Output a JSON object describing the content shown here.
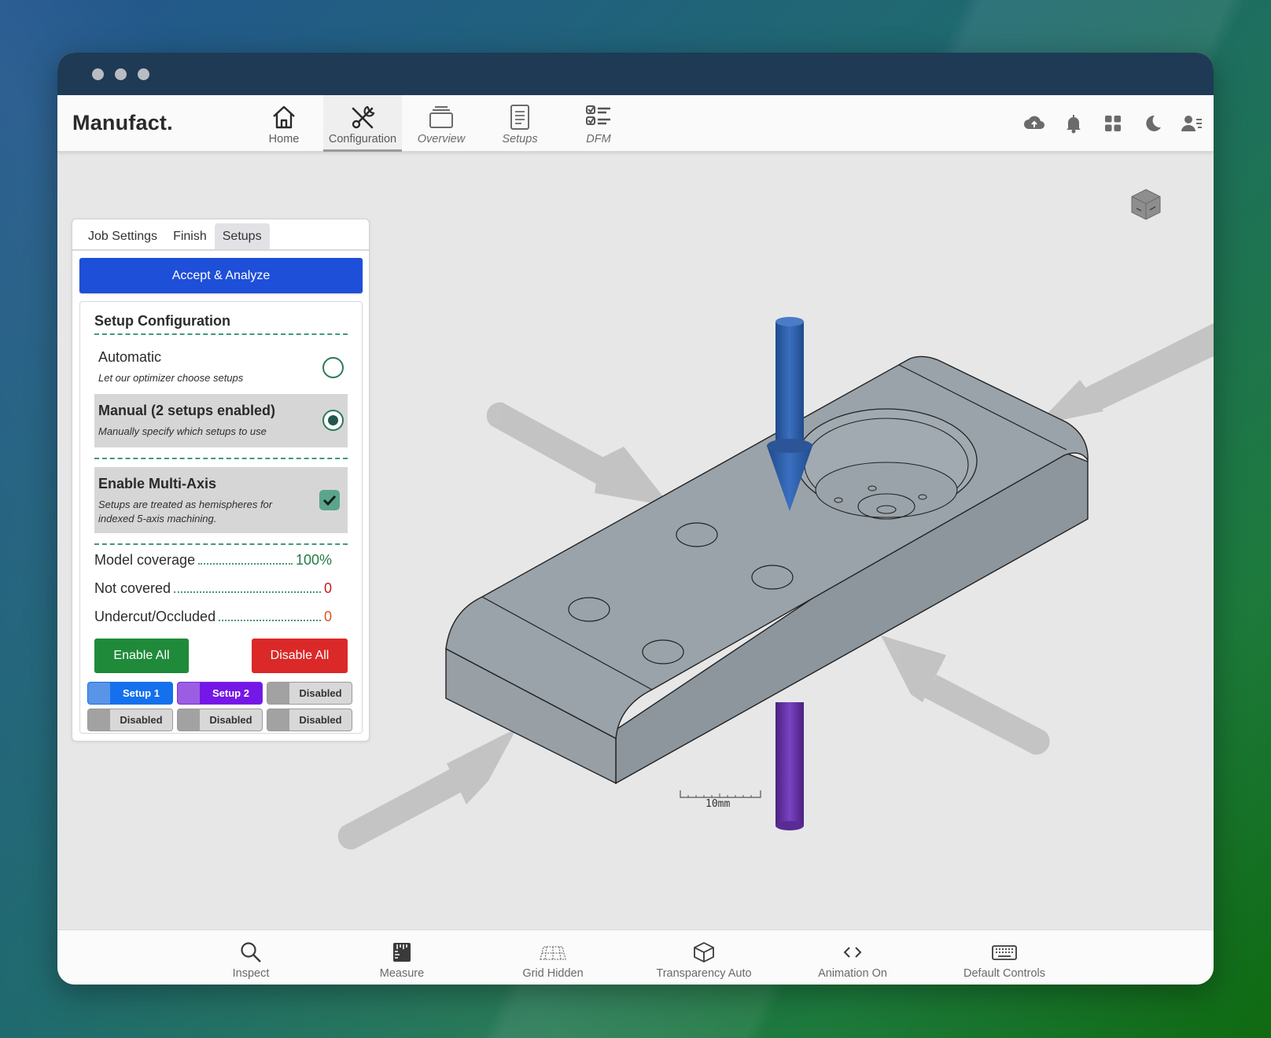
{
  "app": {
    "brand": "Manufact."
  },
  "nav": {
    "items": [
      {
        "label": "Home",
        "icon": "home-icon",
        "active": false
      },
      {
        "label": "Configuration",
        "icon": "tools-icon",
        "active": true
      },
      {
        "label": "Overview",
        "icon": "layers-icon",
        "active": false
      },
      {
        "label": "Setups",
        "icon": "list-icon",
        "active": false
      },
      {
        "label": "DFM",
        "icon": "checklist-icon",
        "active": false
      }
    ],
    "right_icons": [
      "cloud-upload-icon",
      "bell-icon",
      "grid-icon",
      "moon-icon",
      "user-menu-icon"
    ]
  },
  "panel": {
    "tabs": [
      "Job Settings",
      "Finish",
      "Setups"
    ],
    "active_tab": "Setups",
    "accept_label": "Accept & Analyze",
    "config_title": "Setup Configuration",
    "automatic": {
      "title": "Automatic",
      "desc": "Let our optimizer choose setups",
      "selected": false
    },
    "manual": {
      "title": "Manual (2 setups enabled)",
      "desc": "Manually specify which setups to use",
      "selected": true
    },
    "multi_axis": {
      "title": "Enable Multi-Axis",
      "desc_line1": "Setups are treated as hemispheres for",
      "desc_line2": "indexed 5-axis machining.",
      "checked": true
    },
    "stats": {
      "model_coverage_label": "Model coverage",
      "model_coverage_value": "100%",
      "not_covered_label": "Not covered",
      "not_covered_value": "0",
      "undercut_label": "Undercut/Occluded",
      "undercut_value": "0"
    },
    "enable_all_label": "Enable All",
    "disable_all_label": "Disable All",
    "setups": [
      {
        "label": "Setup 1",
        "state": "blue"
      },
      {
        "label": "Setup 2",
        "state": "purple"
      },
      {
        "label": "Disabled",
        "state": "gray"
      },
      {
        "label": "Disabled",
        "state": "gray"
      },
      {
        "label": "Disabled",
        "state": "gray"
      },
      {
        "label": "Disabled",
        "state": "gray"
      }
    ]
  },
  "viewport": {
    "scale_label": "10mm",
    "colors": {
      "part": "#9aa3a9",
      "tool_blue": "#2f5ea4",
      "tool_purple": "#6b3aa8",
      "ghost": "#bdbdbd"
    }
  },
  "toolbar": {
    "items": [
      {
        "label": "Inspect",
        "icon": "search-icon"
      },
      {
        "label": "Measure",
        "icon": "ruler-icon"
      },
      {
        "label": "Grid Hidden",
        "icon": "grid-plane-icon"
      },
      {
        "label": "Transparency Auto",
        "icon": "cube-icon"
      },
      {
        "label": "Animation On",
        "icon": "code-brackets-icon"
      },
      {
        "label": "Default Controls",
        "icon": "keyboard-icon"
      }
    ]
  }
}
